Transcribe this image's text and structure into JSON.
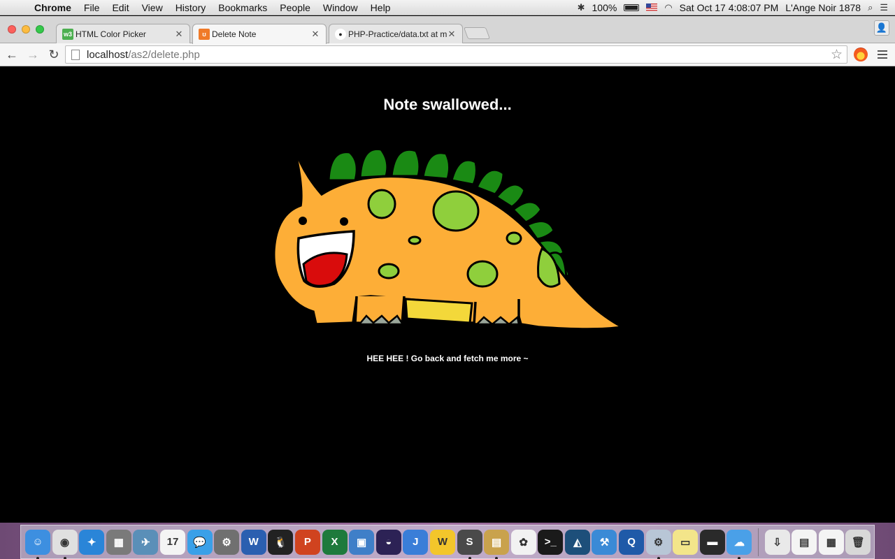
{
  "menubar": {
    "app_name": "Chrome",
    "items": [
      "File",
      "Edit",
      "View",
      "History",
      "Bookmarks",
      "People",
      "Window",
      "Help"
    ],
    "battery": "100%",
    "datetime": "Sat Oct 17  4:08:07 PM",
    "user": "L'Ange Noir 1878"
  },
  "tabs": [
    {
      "title": "HTML Color Picker",
      "favicon": "w3-icon",
      "favicon_text": "w3",
      "favicon_color": "#4caf50",
      "active": false
    },
    {
      "title": "Delete Note",
      "favicon": "xampp-icon",
      "favicon_text": "ʊ",
      "favicon_color": "#f07a28",
      "active": true
    },
    {
      "title": "PHP-Practice/data.txt at m",
      "favicon": "github-icon",
      "favicon_text": "●",
      "favicon_color": "#222222",
      "active": false
    }
  ],
  "address_bar": {
    "host": "localhost",
    "path": "/as2/delete.php"
  },
  "page": {
    "heading": "Note swallowed...",
    "message": "HEE HEE ! Go back and fetch me more ~",
    "background": "#000000"
  },
  "dino_colors": {
    "body": "#fdae37",
    "spikes": "#1a8a14",
    "spots": "#8fcf3c",
    "tongue": "#d90c0c",
    "belly": "#f3d83a",
    "toes": "#9aa69a"
  },
  "dock": {
    "apps": [
      {
        "name": "finder-icon",
        "color": "#3d8fe0",
        "label": "☺",
        "running": true
      },
      {
        "name": "chrome-icon",
        "color": "#e0e0e0",
        "label": "◉",
        "running": true
      },
      {
        "name": "safari-icon",
        "color": "#2a85d8",
        "label": "✦",
        "running": false
      },
      {
        "name": "calculator-icon",
        "color": "#7a7a7a",
        "label": "▦",
        "running": false
      },
      {
        "name": "preview-icon",
        "color": "#5a8fb8",
        "label": "✈",
        "running": false
      },
      {
        "name": "calendar-icon",
        "color": "#f4f4f4",
        "label": "17",
        "running": false
      },
      {
        "name": "messages-icon",
        "color": "#3aa0e8",
        "label": "💬",
        "running": true
      },
      {
        "name": "system-preferences-icon",
        "color": "#707070",
        "label": "⚙",
        "running": false
      },
      {
        "name": "word-icon",
        "color": "#2b5fb0",
        "label": "W",
        "running": false
      },
      {
        "name": "qq-icon",
        "color": "#222222",
        "label": "🐧",
        "running": false
      },
      {
        "name": "powerpoint-icon",
        "color": "#d0431f",
        "label": "P",
        "running": false
      },
      {
        "name": "excel-icon",
        "color": "#1e7a3c",
        "label": "X",
        "running": false
      },
      {
        "name": "virtualbox-icon",
        "color": "#3f7fc8",
        "label": "▣",
        "running": false
      },
      {
        "name": "eclipse-icon",
        "color": "#2c2255",
        "label": "◒",
        "running": false
      },
      {
        "name": "intellij-icon",
        "color": "#3a7ed8",
        "label": "J",
        "running": false
      },
      {
        "name": "wordpress-icon",
        "color": "#f3c62b",
        "label": "W",
        "running": false
      },
      {
        "name": "sublime-text-icon",
        "color": "#4a4a4a",
        "label": "S",
        "running": true
      },
      {
        "name": "archive-icon",
        "color": "#c9a24d",
        "label": "▤",
        "running": true
      },
      {
        "name": "photos-icon",
        "color": "#f2f2f2",
        "label": "✿",
        "running": false
      },
      {
        "name": "terminal-icon",
        "color": "#1a1a1a",
        "label": ">_",
        "running": false
      },
      {
        "name": "mysql-workbench-icon",
        "color": "#1d4f7a",
        "label": "◭",
        "running": false
      },
      {
        "name": "xcode-icon",
        "color": "#3a8ad6",
        "label": "⚒",
        "running": false
      },
      {
        "name": "quicktime-icon",
        "color": "#1f5aa8",
        "label": "Q",
        "running": false
      },
      {
        "name": "utilities-icon",
        "color": "#b8c6d6",
        "label": "⚙",
        "running": true
      },
      {
        "name": "stickies-icon",
        "color": "#f3e58a",
        "label": "▭",
        "running": false
      },
      {
        "name": "printer-icon",
        "color": "#2a2a2a",
        "label": "▬",
        "running": false
      },
      {
        "name": "icloud-icon",
        "color": "#4aa0e8",
        "label": "☁",
        "running": true
      }
    ],
    "stack_items": [
      {
        "name": "downloads-stack-icon",
        "color": "#e9e9e9",
        "label": "⇩"
      },
      {
        "name": "documents-stack-icon",
        "color": "#f4f4f4",
        "label": "▤"
      },
      {
        "name": "screenshots-stack-icon",
        "color": "#f4f4f4",
        "label": "▦"
      },
      {
        "name": "trash-icon",
        "color": "#d8d8d8",
        "label": "🗑"
      }
    ]
  }
}
